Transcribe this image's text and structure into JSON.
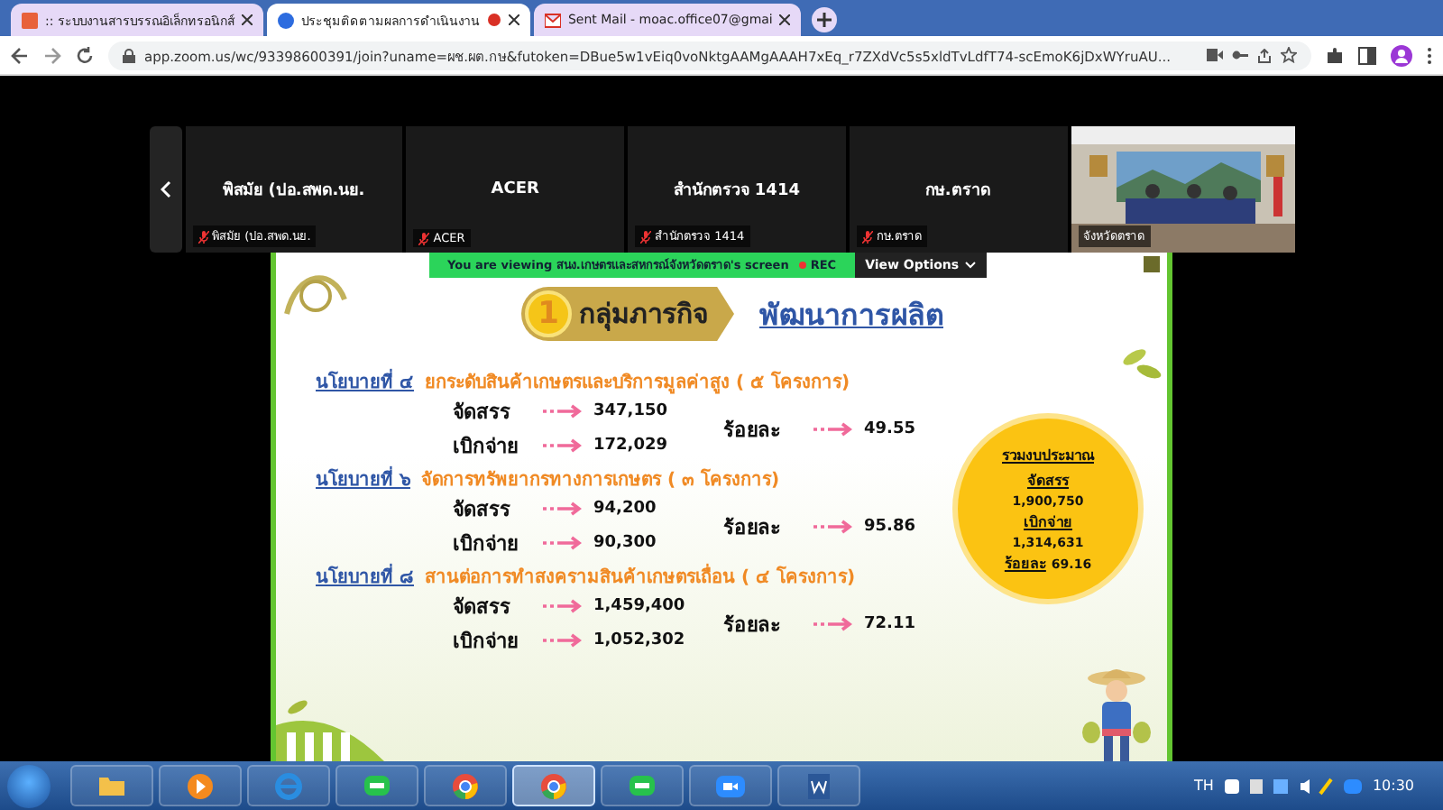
{
  "browser": {
    "tabs": [
      {
        "title": ":: ระบบงานสารบรรณอิเล็กทรอนิกส์",
        "selected": false,
        "kind": "doc"
      },
      {
        "title": "ประชุมติดตามผลการดำเนินงาน",
        "selected": true,
        "kind": "zoom",
        "recording": true
      },
      {
        "title": "Sent Mail - moac.office07@gmai",
        "selected": false,
        "kind": "mail"
      }
    ],
    "url": "app.zoom.us/wc/93398600391/join?uname=ผช.ผต.กษ&futoken=DBue5w1vEiq0voNktgAAMgAAAH7xEq_r7ZXdVc5s5xldTvLdfT74-scEmoK6jDxWYruAU..."
  },
  "participants": [
    {
      "kind": "tile",
      "name": "พิสมัย (ปอ.สพด.นย.",
      "label": "พิสมัย (ปอ.สพด.นย.",
      "muted": true
    },
    {
      "kind": "tile",
      "name": "ACER",
      "label": "ACER",
      "muted": true
    },
    {
      "kind": "tile",
      "name": "สำนักตรวจ 1414",
      "label": "สำนักตรวจ 1414",
      "muted": true
    },
    {
      "kind": "tile",
      "name": "กษ.ตราด",
      "label": "กษ.ตราด",
      "muted": true
    },
    {
      "kind": "video",
      "label": "จังหวัดตราด"
    }
  ],
  "share_banner": {
    "text": "You are viewing  สนง.เกษตรและสหกรณ์จังหวัดตราด's screen",
    "rec": "REC",
    "view_options": "View Options"
  },
  "slide": {
    "number": "1",
    "group": "กลุ่มภารกิจ",
    "title": "พัฒนาการผลิต",
    "policies": [
      {
        "label": "นโยบายที่ ๔",
        "title": "ยกระดับสินค้าเกษตรและบริการมูลค่าสูง ( ๕ โครงการ)",
        "rows": [
          {
            "label": "จัดสรร",
            "value": "347,150"
          },
          {
            "label": "เบิกจ่าย",
            "value": "172,029"
          }
        ],
        "percent_label": "ร้อยละ",
        "percent": "49.55"
      },
      {
        "label": "นโยบายที่ ๖",
        "title": "จัดการทรัพยากรทางการเกษตร ( ๓ โครงการ)",
        "rows": [
          {
            "label": "จัดสรร",
            "value": "94,200"
          },
          {
            "label": "เบิกจ่าย",
            "value": "90,300"
          }
        ],
        "percent_label": "ร้อยละ",
        "percent": "95.86"
      },
      {
        "label": "นโยบายที่ ๘",
        "title": "สานต่อการทำสงครามสินค้าเกษตรเถื่อน ( ๔ โครงการ)",
        "rows": [
          {
            "label": "จัดสรร",
            "value": "1,459,400"
          },
          {
            "label": "เบิกจ่าย",
            "value": "1,052,302"
          }
        ],
        "percent_label": "ร้อยละ",
        "percent": "72.11"
      }
    ],
    "summary": {
      "title": "รวมงบประมาณ",
      "allot_label": "จัดสรร",
      "allot": "1,900,750",
      "spent_label": "เบิกจ่าย",
      "spent": "1,314,631",
      "percent_label": "ร้อยละ",
      "percent": "69.16"
    }
  },
  "taskbar": {
    "apps": [
      {
        "kind": "folder",
        "selected": false
      },
      {
        "kind": "media",
        "selected": false
      },
      {
        "kind": "ie",
        "selected": false
      },
      {
        "kind": "line",
        "selected": false
      },
      {
        "kind": "chrome",
        "selected": false
      },
      {
        "kind": "chrome",
        "selected": true
      },
      {
        "kind": "line",
        "selected": false
      },
      {
        "kind": "zoom",
        "selected": false
      },
      {
        "kind": "word",
        "selected": false
      }
    ],
    "language": "TH",
    "clock": "10:30"
  }
}
